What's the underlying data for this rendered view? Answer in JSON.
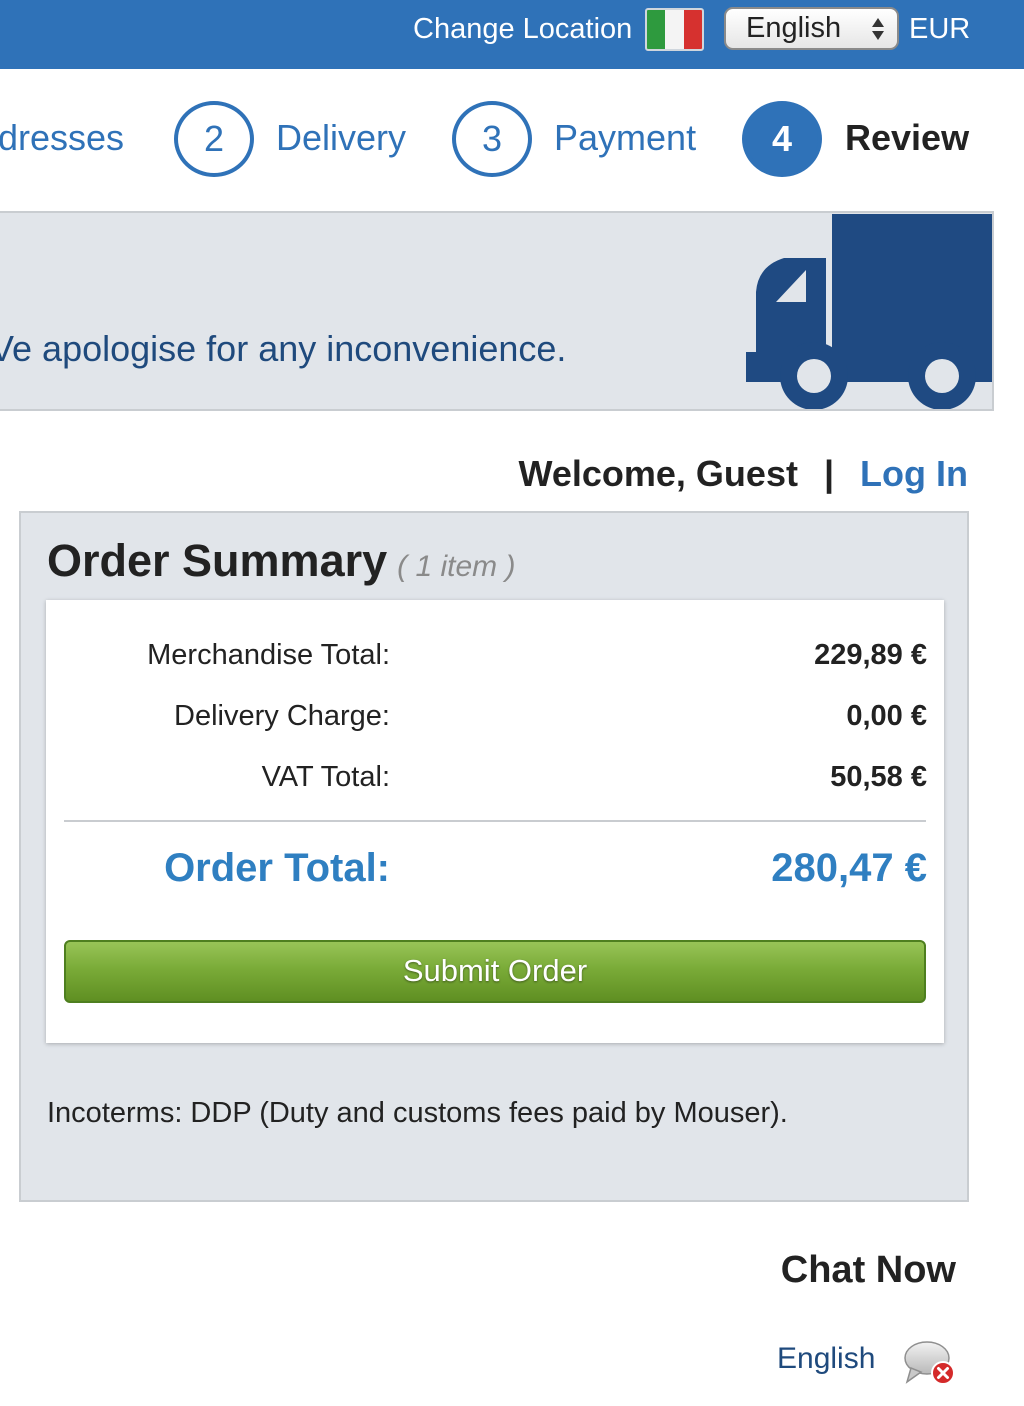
{
  "topbar": {
    "change_location": "Change Location",
    "language": "English",
    "currency": "EUR",
    "flag_colors": [
      "#2e9a3e",
      "#f4f4f4",
      "#d6312f"
    ],
    "bar_color": "#2f72b8"
  },
  "steps": [
    {
      "label": "dresses"
    },
    {
      "number": "2",
      "label": "Delivery"
    },
    {
      "number": "3",
      "label": "Payment"
    },
    {
      "number": "4",
      "label": "Review",
      "active": true
    }
  ],
  "banner": {
    "text": "Ve apologise for any inconvenience.",
    "icon": "truck-icon"
  },
  "welcome": {
    "greeting": "Welcome, Guest",
    "separator": "|",
    "login": "Log In"
  },
  "order_summary": {
    "title": "Order Summary",
    "item_count": "( 1 item )",
    "rows": [
      {
        "label": "Merchandise Total:",
        "value": "229,89 €"
      },
      {
        "label": "Delivery Charge:",
        "value": "0,00 €"
      },
      {
        "label": "VAT Total:",
        "value": "50,58 €"
      }
    ],
    "total_label": "Order Total:",
    "total_value": "280,47 €",
    "submit_label": "Submit Order",
    "incoterms": "Incoterms: DDP (Duty and customs fees paid by Mouser)."
  },
  "chat": {
    "title": "Chat Now",
    "language": "English",
    "icon": "chat-offline-icon"
  }
}
